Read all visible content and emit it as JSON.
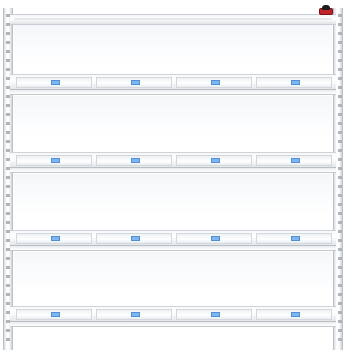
{
  "rack": {
    "shelves": [
      {
        "slots": [
          {
            "tag": "blue-label"
          },
          {
            "tag": "blue-label"
          },
          {
            "tag": "blue-label"
          },
          {
            "tag": "blue-label"
          }
        ]
      },
      {
        "slots": [
          {
            "tag": "blue-label"
          },
          {
            "tag": "blue-label"
          },
          {
            "tag": "blue-label"
          },
          {
            "tag": "blue-label"
          }
        ]
      },
      {
        "slots": [
          {
            "tag": "blue-label"
          },
          {
            "tag": "blue-label"
          },
          {
            "tag": "blue-label"
          },
          {
            "tag": "blue-label"
          }
        ]
      },
      {
        "slots": [
          {
            "tag": "blue-label"
          },
          {
            "tag": "blue-label"
          },
          {
            "tag": "blue-label"
          },
          {
            "tag": "blue-label"
          }
        ]
      }
    ],
    "colors": {
      "frame": "#ffffff",
      "frame_shadow": "#b9c0c6",
      "label": "#7fb6f0",
      "stop_button": "#c2222a"
    },
    "icons": {
      "emergency_stop": "emergency-stop-icon"
    }
  }
}
